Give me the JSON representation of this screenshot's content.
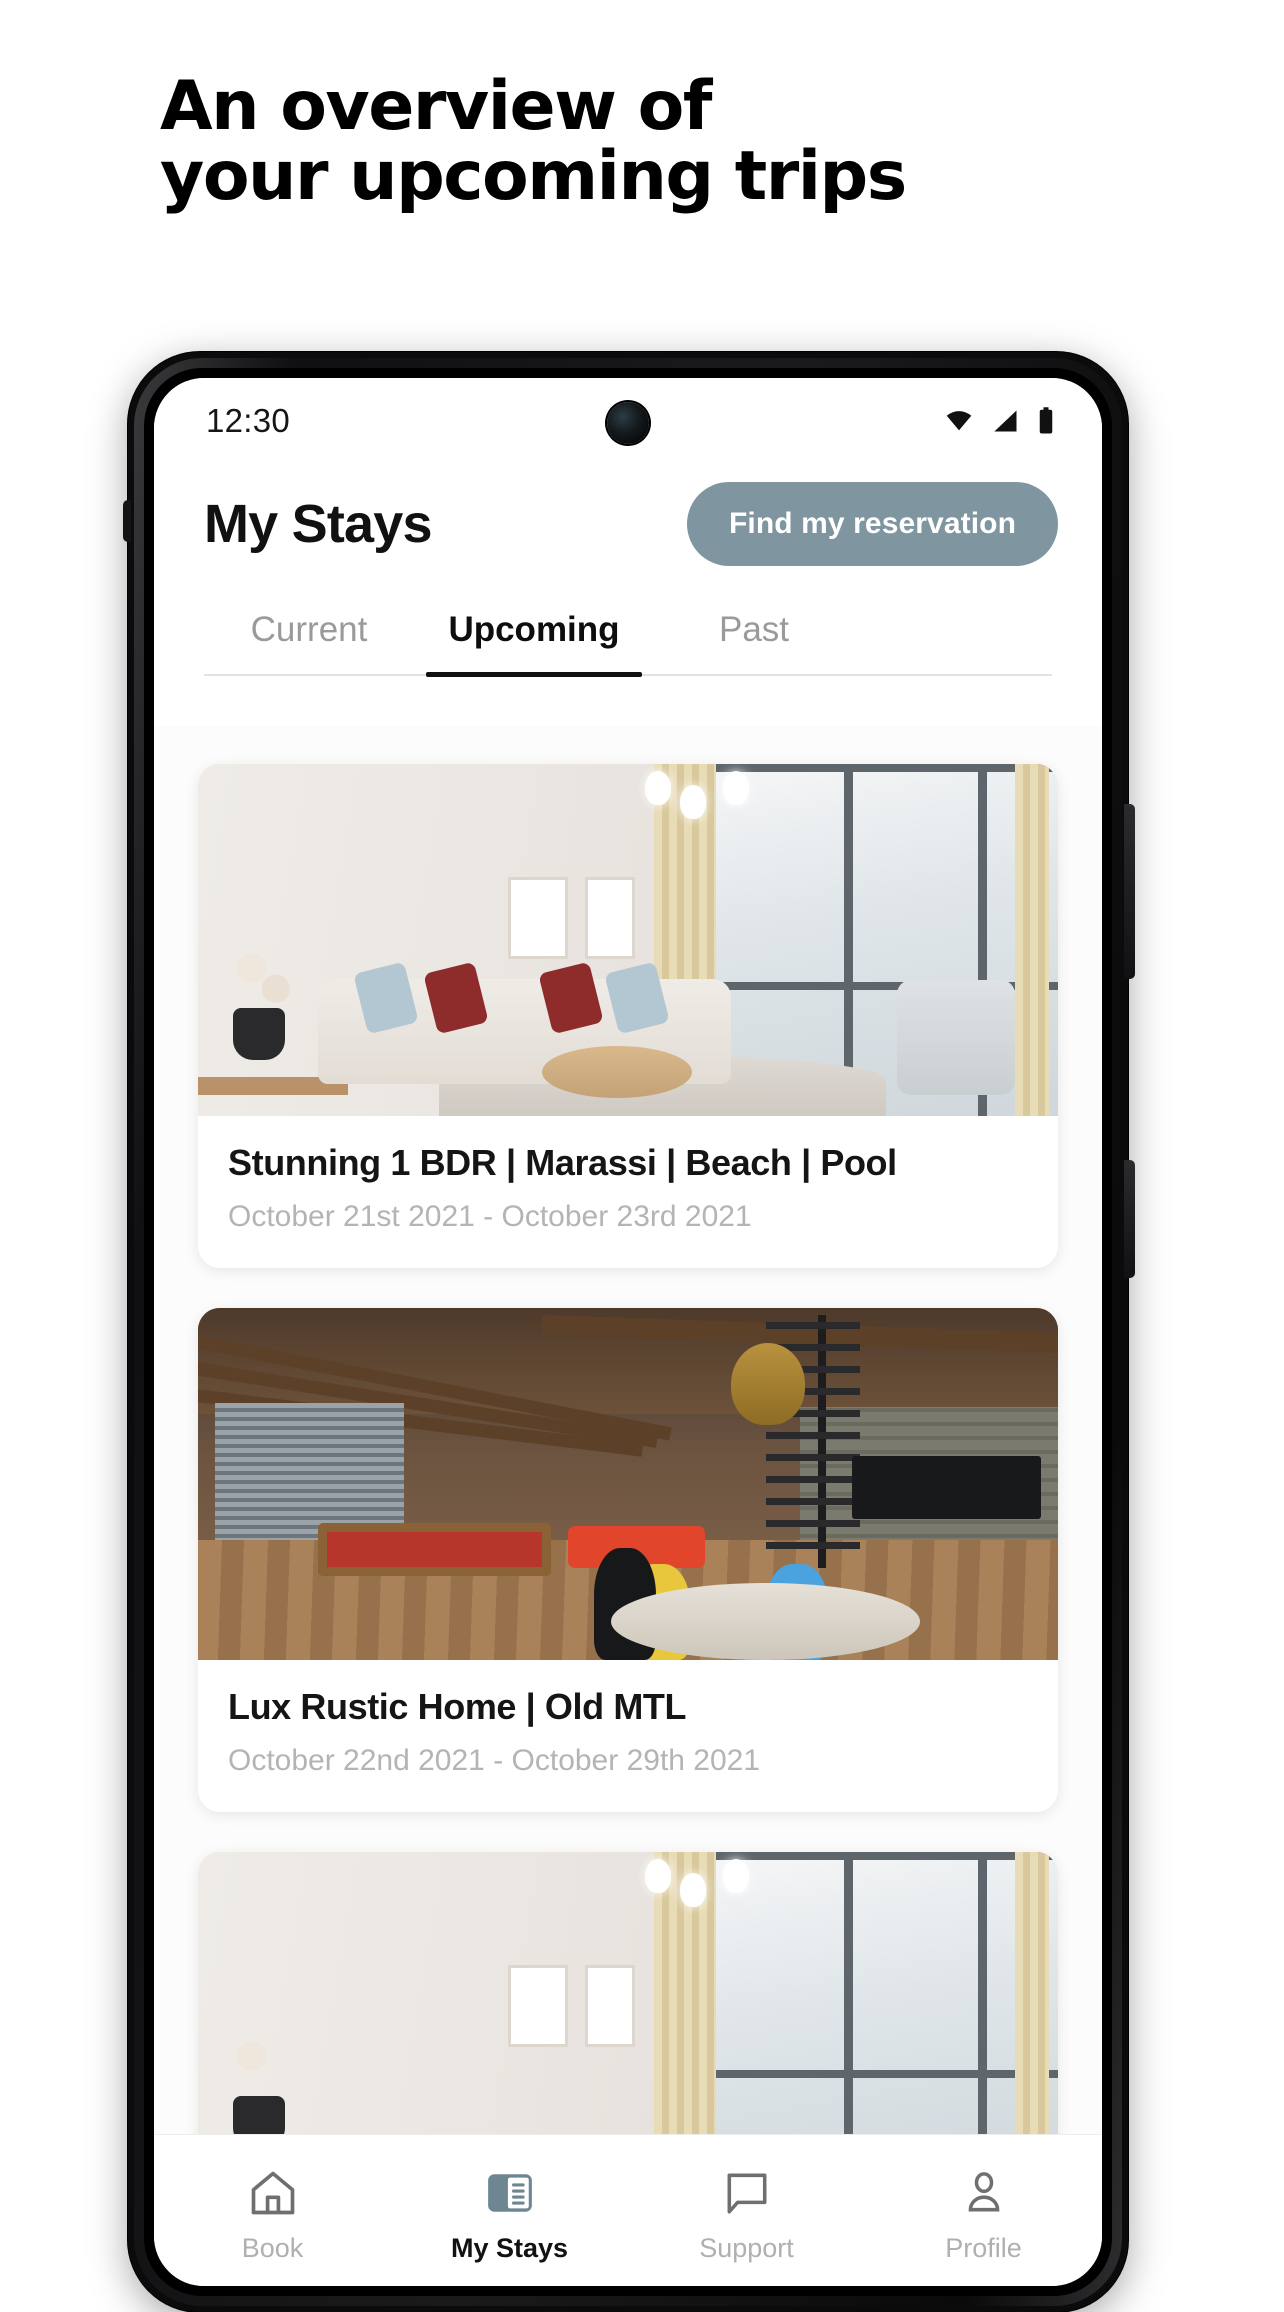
{
  "marketing": {
    "headline_line1": "An overview of",
    "headline_line2": "your upcoming trips"
  },
  "phone": {
    "status_bar": {
      "time": "12:30",
      "icons": [
        "wifi-icon",
        "cellular-signal-icon",
        "battery-icon"
      ]
    }
  },
  "app": {
    "header": {
      "title": "My Stays",
      "find_button_label": "Find my reservation",
      "find_button_color": "#7f959f"
    },
    "tabs": [
      {
        "label": "Current",
        "active": false
      },
      {
        "label": "Upcoming",
        "active": true
      },
      {
        "label": "Past",
        "active": false
      }
    ],
    "stays": [
      {
        "title": "Stunning 1 BDR | Marassi | Beach | Pool",
        "dates": "October 21st 2021 - October 23rd 2021",
        "photo": "bright-modern-living-room"
      },
      {
        "title": "Lux Rustic Home | Old MTL",
        "dates": "October 22nd 2021 - October 29th 2021",
        "photo": "rustic-loft-pool-table"
      },
      {
        "title": "",
        "dates": "",
        "photo": "bright-modern-living-room"
      }
    ],
    "bottom_nav": [
      {
        "label": "Book",
        "icon": "home-icon",
        "active": false
      },
      {
        "label": "My Stays",
        "icon": "stays-list-icon",
        "active": true
      },
      {
        "label": "Support",
        "icon": "chat-bubble-icon",
        "active": false
      },
      {
        "label": "Profile",
        "icon": "person-icon",
        "active": false
      }
    ],
    "colors": {
      "accent": "#7f959f",
      "active_text": "#121212",
      "muted_text": "#b0b0b0",
      "date_text": "#b4b4b4"
    }
  }
}
